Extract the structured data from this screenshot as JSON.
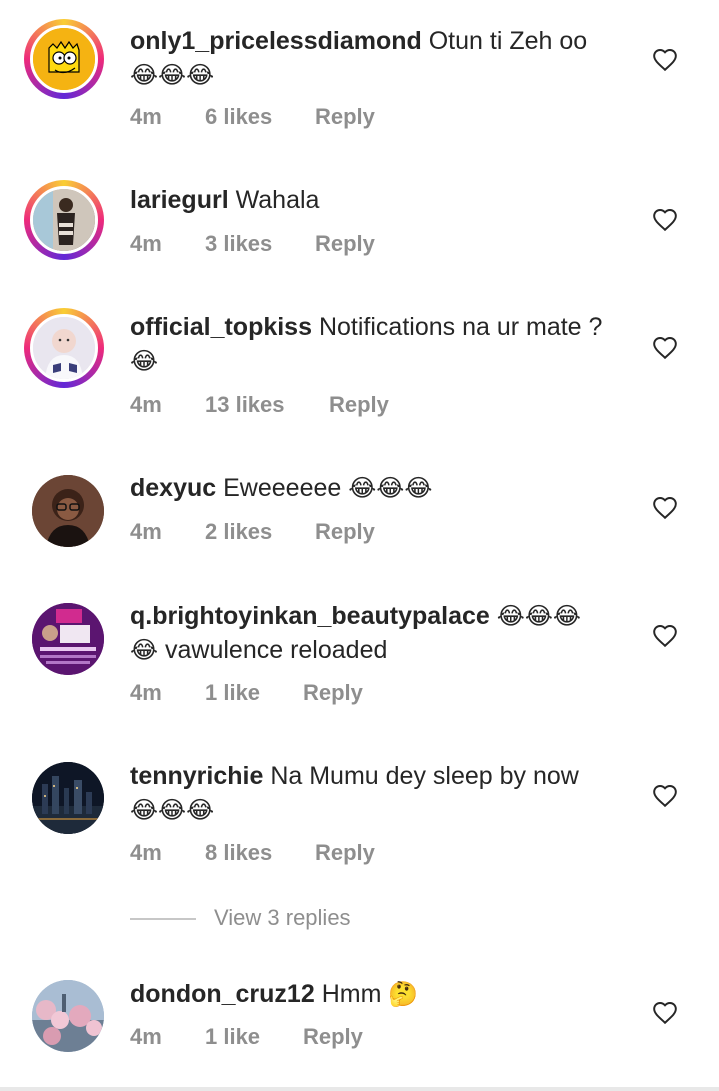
{
  "comments": [
    {
      "username": "only1_pricelessdiamond",
      "text": "Otun ti Zeh oo",
      "emoji": "😂😂😂",
      "time": "4m",
      "likes": "6 likes",
      "reply": "Reply"
    },
    {
      "username": "lariegurl",
      "text": "Wahala",
      "time": "4m",
      "likes": "3 likes",
      "reply": "Reply"
    },
    {
      "username": "official_topkiss",
      "text": "Notifications na ur mate ?",
      "emoji": "😂",
      "time": "4m",
      "likes": "13 likes",
      "reply": "Reply"
    },
    {
      "username": "dexyuc",
      "text": "Eweeeeee",
      "emoji": "😂😂😂",
      "time": "4m",
      "likes": "2 likes",
      "reply": "Reply"
    },
    {
      "username": "q.brightoyinkan_beautypalace",
      "emoji": "😂😂😂",
      "emoji2": "😂",
      "text": "vawulence reloaded",
      "time": "4m",
      "likes": "1 like",
      "reply": "Reply"
    },
    {
      "username": "tennyrichie",
      "text": "Na Mumu dey sleep by now",
      "emoji": "😂😂😂",
      "time": "4m",
      "likes": "8 likes",
      "reply": "Reply"
    },
    {
      "username": "dondon_cruz12",
      "text": "Hmm",
      "emoji": "🤔",
      "time": "4m",
      "likes": "1 like",
      "reply": "Reply"
    }
  ],
  "view_replies": "View 3 replies",
  "icons": {
    "like": "heart-outline-icon"
  },
  "colors": {
    "text": "#262626",
    "secondary": "#8e8e8e",
    "ring_start": "#f9ce34",
    "ring_mid": "#ee2a7b",
    "ring_end": "#6228d7"
  }
}
